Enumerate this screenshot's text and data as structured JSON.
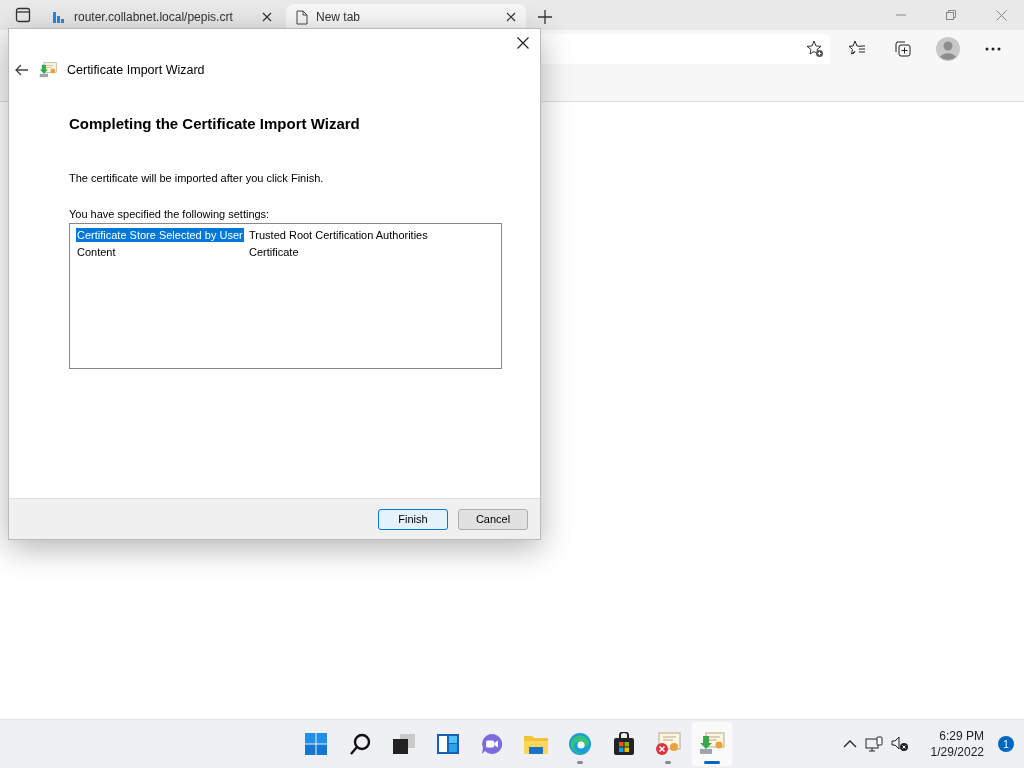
{
  "browser": {
    "tabs": [
      {
        "title": "router.collabnet.local/pepis.crt",
        "selected": false
      },
      {
        "title": "New tab",
        "selected": true
      }
    ]
  },
  "dialog": {
    "title": "Certificate Import Wizard",
    "heading": "Completing the Certificate Import Wizard",
    "message": "The certificate will be imported after you click Finish.",
    "settings_label": "You have specified the following settings:",
    "settings": [
      {
        "name": "Certificate Store Selected by User",
        "value": "Trusted Root Certification Authorities",
        "selected": true
      },
      {
        "name": "Content",
        "value": "Certificate",
        "selected": false
      }
    ],
    "buttons": [
      {
        "label": "Finish",
        "default": true
      },
      {
        "label": "Cancel",
        "default": false
      }
    ]
  },
  "taskbar": {
    "apps": [
      {
        "kind": "start",
        "running": false,
        "active": false
      },
      {
        "kind": "search",
        "running": false,
        "active": false
      },
      {
        "kind": "taskview",
        "running": false,
        "active": false
      },
      {
        "kind": "widgets",
        "running": false,
        "active": false
      },
      {
        "kind": "chat",
        "running": false,
        "active": false
      },
      {
        "kind": "explorer",
        "running": false,
        "active": false
      },
      {
        "kind": "edge",
        "running": true,
        "active": false
      },
      {
        "kind": "store",
        "running": false,
        "active": false
      },
      {
        "kind": "certerror",
        "running": true,
        "active": false
      },
      {
        "kind": "certwizard",
        "running": true,
        "active": true
      }
    ],
    "time": "6:29 PM",
    "date": "1/29/2022",
    "notifications": "1"
  }
}
